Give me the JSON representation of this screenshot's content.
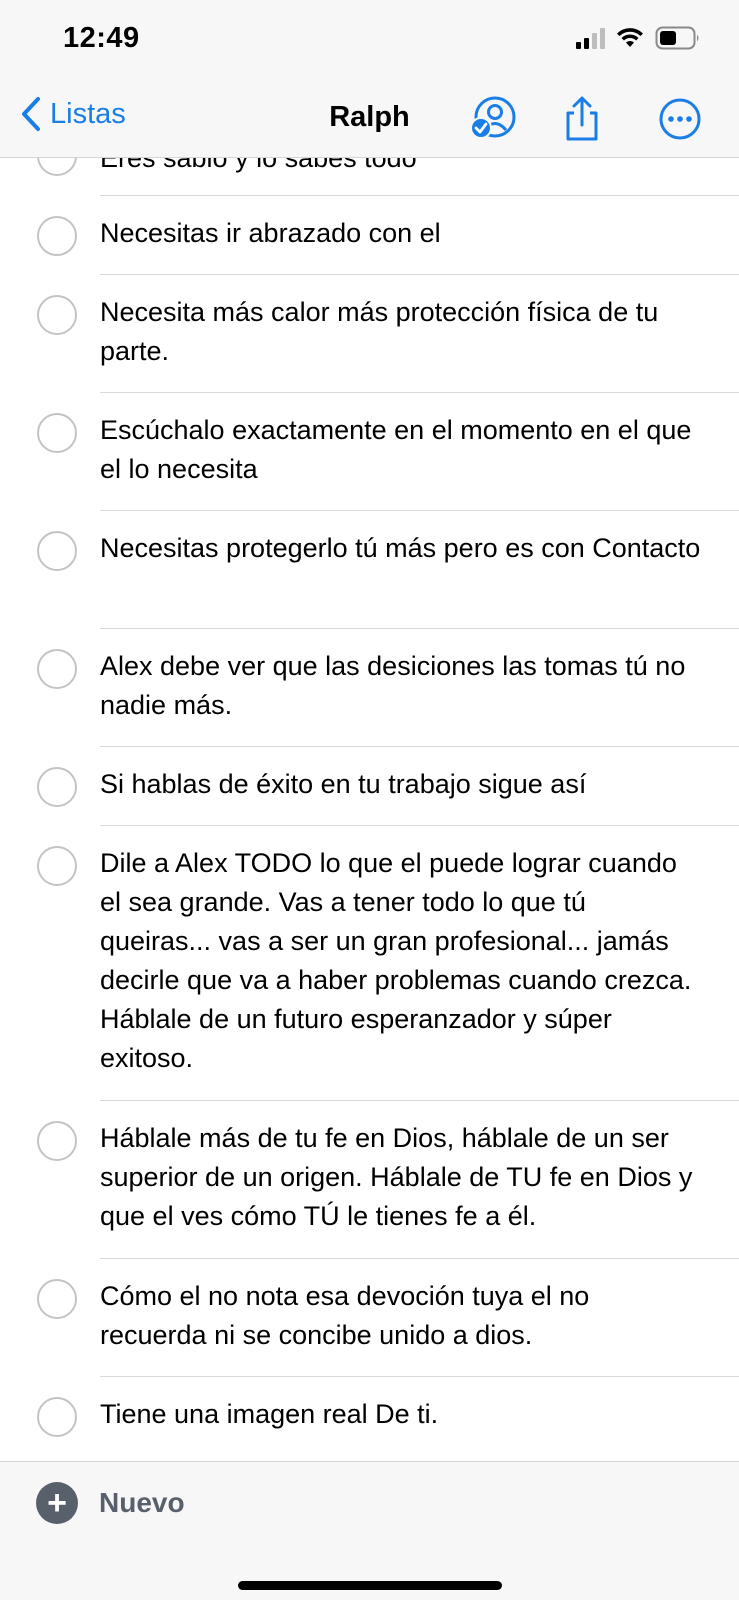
{
  "status_bar": {
    "time": "12:49"
  },
  "nav": {
    "back_label": "Listas",
    "title": "Ralph",
    "accent_color": "#1a7ee6",
    "icons": [
      "chevron-left-icon",
      "shared-person-icon",
      "share-icon",
      "more-icon"
    ]
  },
  "items": [
    {
      "text": "Eres sabio y lo sabes todo",
      "completed": false
    },
    {
      "text": "Necesitas ir abrazado con el",
      "completed": false
    },
    {
      "text": "Necesita más calor más protección física de tu parte.",
      "completed": false
    },
    {
      "text": "Escúchalo exactamente en el momento en el que el lo necesita",
      "completed": false
    },
    {
      "text": "Necesitas protegerlo tú más pero es con Contacto",
      "completed": false
    },
    {
      "text": "Alex debe ver que las desiciones las tomas tú no nadie más.",
      "completed": false
    },
    {
      "text": "Si hablas de éxito en tu trabajo sigue así",
      "completed": false
    },
    {
      "text": "Dile a Alex TODO lo que el puede lograr cuando el sea grande. Vas a tener todo lo que tú queiras... vas a ser un gran profesional... jamás decirle que va a haber problemas cuando crezca. Háblale de un futuro esperanzador y súper exitoso.",
      "completed": false
    },
    {
      "text": "Háblale más de tu fe en Dios, háblale de un ser superior de un origen. Háblale de TU fe en Dios y que el ves cómo TÚ le tienes fe a él.",
      "completed": false
    },
    {
      "text": "Cómo el no nota esa devoción tuya el no recuerda ni se concibe unido a dios.",
      "completed": false
    },
    {
      "text": "Tiene una imagen real De ti.",
      "completed": false
    }
  ],
  "footer": {
    "new_label": "Nuevo",
    "new_color": "#58606c"
  }
}
